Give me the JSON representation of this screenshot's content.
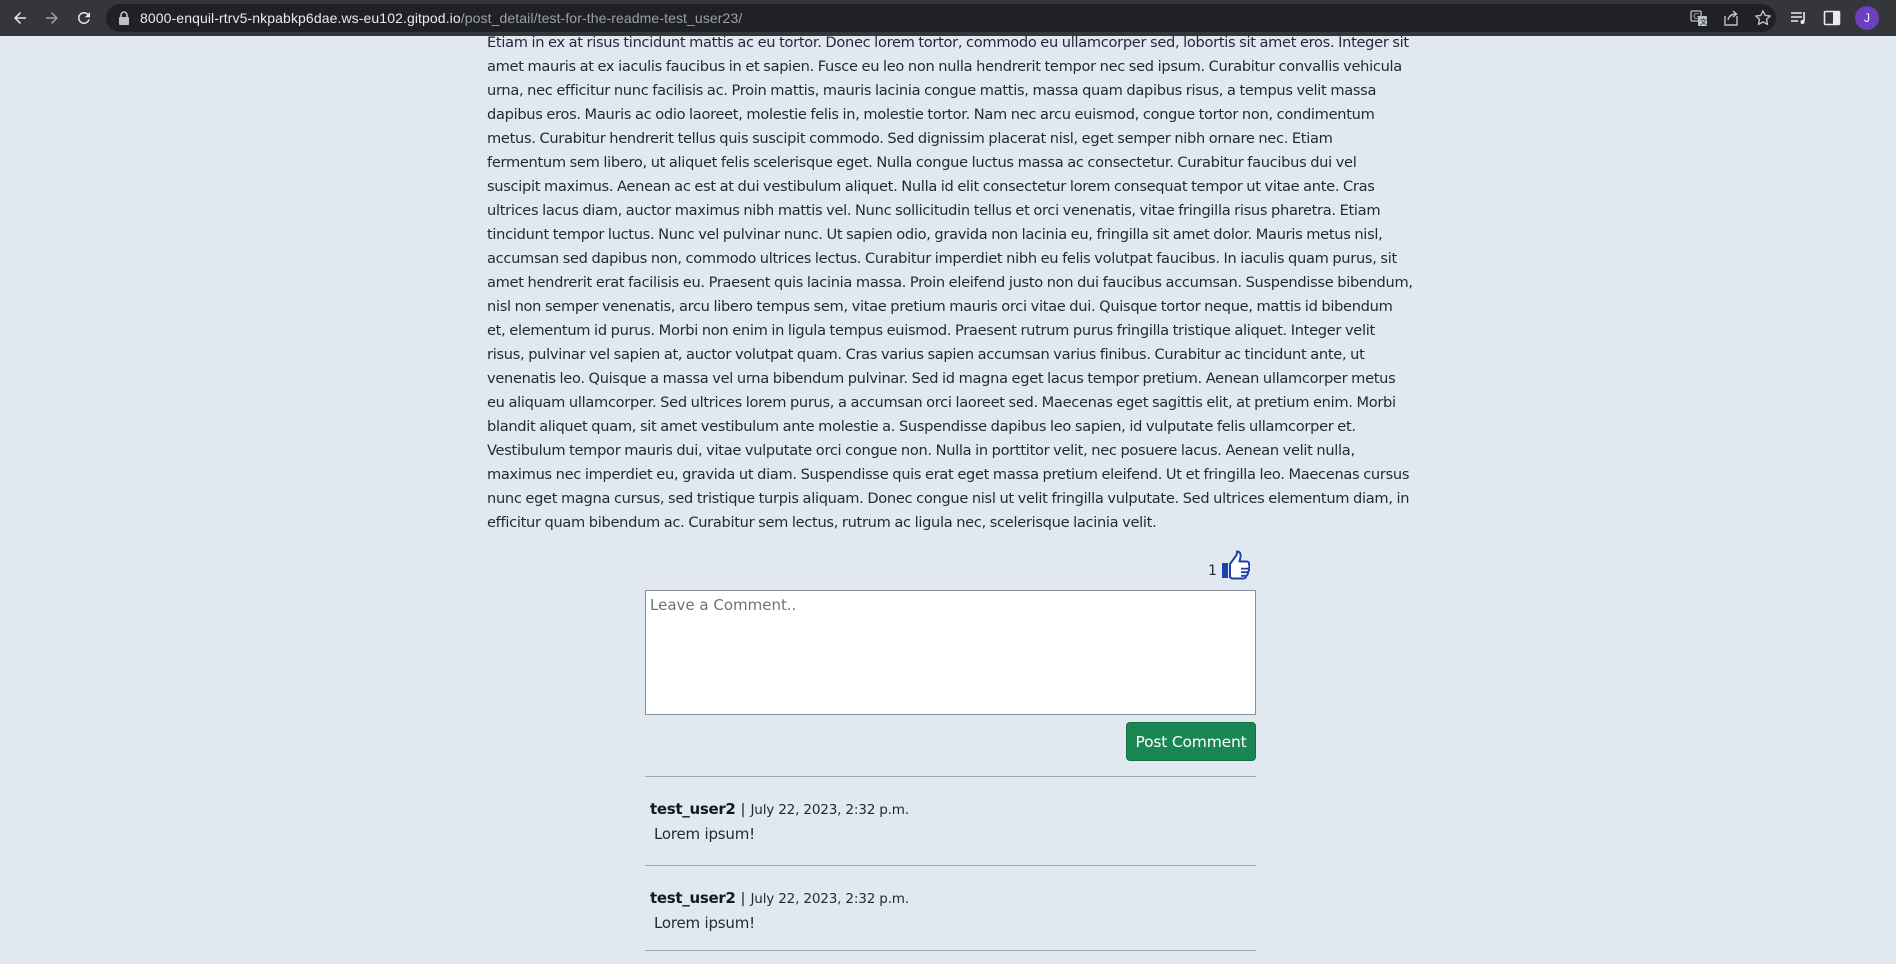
{
  "browser": {
    "url_host": "8000-enquil-rtrv5-nkpabkp6dae.ws-eu102.gitpod.io",
    "url_path": "/post_detail/test-for-the-readme-test_user23/",
    "profile_initial": "J"
  },
  "post": {
    "body": "Etiam in ex at risus tincidunt mattis ac eu tortor. Donec lorem tortor, commodo eu ullamcorper sed, lobortis sit amet eros. Integer sit amet mauris at ex iaculis faucibus in et sapien. Fusce eu leo non nulla hendrerit tempor nec sed ipsum. Curabitur convallis vehicula urna, nec efficitur nunc facilisis ac. Proin mattis, mauris lacinia congue mattis, massa quam dapibus risus, a tempus velit massa dapibus eros. Mauris ac odio laoreet, molestie felis in, molestie tortor. Nam nec arcu euismod, congue tortor non, condimentum metus. Curabitur hendrerit tellus quis suscipit commodo. Sed dignissim placerat nisl, eget semper nibh ornare nec. Etiam fermentum sem libero, ut aliquet felis scelerisque eget. Nulla congue luctus massa ac consectetur. Curabitur faucibus dui vel suscipit maximus. Aenean ac est at dui vestibulum aliquet. Nulla id elit consectetur lorem consequat tempor ut vitae ante. Cras ultrices lacus diam, auctor maximus nibh mattis vel. Nunc sollicitudin tellus et orci venenatis, vitae fringilla risus pharetra. Etiam tincidunt tempor luctus. Nunc vel pulvinar nunc. Ut sapien odio, gravida non lacinia eu, fringilla sit amet dolor. Mauris metus nisl, accumsan sed dapibus non, commodo ultrices lectus. Curabitur imperdiet nibh eu felis volutpat faucibus. In iaculis quam purus, sit amet hendrerit erat facilisis eu. Praesent quis lacinia massa. Proin eleifend justo non dui faucibus accumsan. Suspendisse bibendum, nisl non semper venenatis, arcu libero tempus sem, vitae pretium mauris orci vitae dui. Quisque tortor neque, mattis id bibendum et, elementum id purus. Morbi non enim in ligula tempus euismod. Praesent rutrum purus fringilla tristique aliquet. Integer velit risus, pulvinar vel sapien at, auctor volutpat quam. Cras varius sapien accumsan varius finibus. Curabitur ac tincidunt ante, ut venenatis leo. Quisque a massa vel urna bibendum pulvinar. Sed id magna eget lacus tempor pretium. Aenean ullamcorper metus eu aliquam ullamcorper. Sed ultrices lorem purus, a accumsan orci laoreet sed. Maecenas eget sagittis elit, at pretium enim. Morbi blandit aliquet quam, sit amet vestibulum ante molestie a. Suspendisse dapibus leo sapien, id vulputate felis ullamcorper et. Vestibulum tempor mauris dui, vitae vulputate orci congue non. Nulla in porttitor velit, nec posuere lacus. Aenean velit nulla, maximus nec imperdiet eu, gravida ut diam. Suspendisse quis erat eget massa pretium eleifend. Ut et fringilla leo. Maecenas cursus nunc eget magna cursus, sed tristique turpis aliquam. Donec congue nisl ut velit fringilla vulputate. Sed ultrices elementum diam, in efficitur quam bibendum ac. Curabitur sem lectus, rutrum ac ligula nec, scelerisque lacinia velit.",
    "like_count": "1",
    "like_icon": "thumbs-up-icon"
  },
  "comment_form": {
    "placeholder": "Leave a Comment..",
    "submit_label": "Post Comment"
  },
  "comments": [
    {
      "author": "test_user2",
      "separator": "|",
      "date": "July 22, 2023, 2:32 p.m.",
      "body": "Lorem ipsum!"
    },
    {
      "author": "test_user2",
      "separator": "|",
      "date": "July 22, 2023, 2:32 p.m.",
      "body": "Lorem ipsum!"
    }
  ],
  "colors": {
    "page_background": "#e2e8f0",
    "like_icon": "#1e40af",
    "submit_button": "#198754"
  }
}
